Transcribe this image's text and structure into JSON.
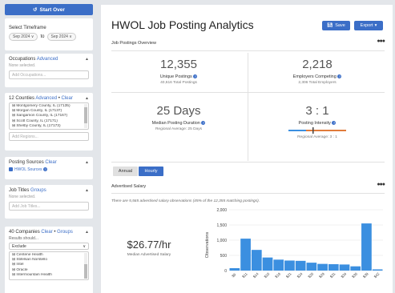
{
  "sidebar": {
    "start_over": "Start Over",
    "timeframe": {
      "title": "Select Timeframe",
      "from": "Sep 2024",
      "to_word": "to",
      "to": "Sep 2024"
    },
    "occupations": {
      "title": "Occupations",
      "link": "Advanced",
      "none": "None selected.",
      "placeholder": "Add Occupations..."
    },
    "counties": {
      "title": "12 Counties",
      "link1": "Advanced",
      "link2": "Clear",
      "items": [
        "Montgomery County, IL (17135)",
        "Morgan County, IL (17137)",
        "Sangamon County, IL (17167)",
        "Scott County, IL (17171)",
        "Shelby County, IL (17173)"
      ],
      "placeholder": "Add Regions..."
    },
    "posting_sources": {
      "title": "Posting Sources",
      "link": "Clear",
      "item": "HWOL Sources"
    },
    "job_titles": {
      "title": "Job Titles",
      "link": "Groups",
      "none": "None selected.",
      "placeholder": "Add Job Titles..."
    },
    "companies": {
      "title": "40 Companies",
      "link1": "Clear",
      "link2": "Groups",
      "results": "Results should...",
      "mode": "Exclude",
      "items": [
        "Centene Health",
        "Stifelsan Norstello",
        "Intel",
        "Oracle",
        "Intermountain Health"
      ]
    }
  },
  "main": {
    "title": "HWOL Job Posting Analytics",
    "save": "Save",
    "export": "Export",
    "overview_title": "Job Postings Overview",
    "stats": {
      "unique_postings": {
        "value": "12,355",
        "label": "Unique Postings",
        "sub": "40,616 Total Postings"
      },
      "employers": {
        "value": "2,218",
        "label": "Employers Competing",
        "sub": "2,306 Total Employers"
      },
      "duration": {
        "value": "25 Days",
        "label": "Median Posting Duration",
        "sub": "Regional Average: 25 Days"
      },
      "intensity": {
        "value": "3 : 1",
        "label": "Posting Intensity",
        "sub": "Regional Average: 3 : 1"
      }
    },
    "tabs": [
      "Annual",
      "Hourly"
    ],
    "salary_title": "Advertised Salary",
    "note": "There are 5,565 advertised salary observations (45% of the 12,355 matching postings).",
    "median_value": "$26.77/hr",
    "median_label": "Median Advertised Salary"
  },
  "chart_data": {
    "type": "bar",
    "ylabel": "Observations",
    "ylim": [
      0,
      2000
    ],
    "yticks": [
      "2,000",
      "1,500",
      "1,000",
      "500",
      "0"
    ],
    "categories": [
      "$9",
      "$11",
      "$14",
      "$16",
      "$19",
      "$21",
      "$24",
      "$26",
      "$29",
      "$31",
      "$34",
      "$36",
      "$39",
      "$42"
    ],
    "values": [
      80,
      1050,
      680,
      430,
      360,
      330,
      320,
      260,
      220,
      210,
      200,
      140,
      1550,
      40
    ],
    "bar_color": "#3b8fe0"
  }
}
